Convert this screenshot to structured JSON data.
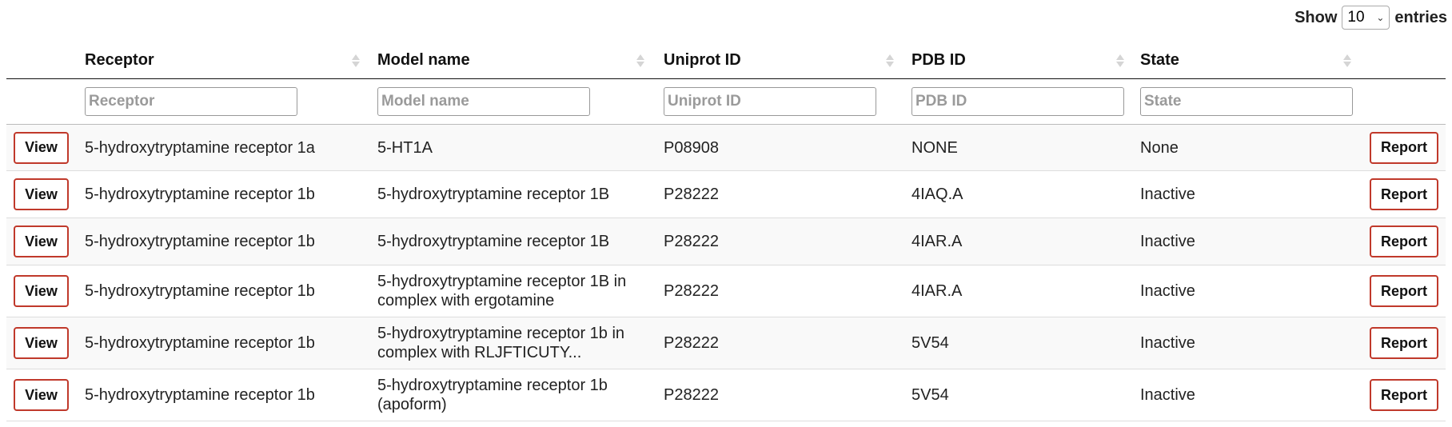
{
  "length_control": {
    "prefix": "Show",
    "selected": "10",
    "suffix": "entries"
  },
  "columns": [
    {
      "key": "receptor",
      "label": "Receptor",
      "placeholder": "Receptor"
    },
    {
      "key": "model_name",
      "label": "Model name",
      "placeholder": "Model name"
    },
    {
      "key": "uniprot_id",
      "label": "Uniprot ID",
      "placeholder": "Uniprot ID"
    },
    {
      "key": "pdb_id",
      "label": "PDB ID",
      "placeholder": "PDB ID"
    },
    {
      "key": "state",
      "label": "State",
      "placeholder": "State"
    }
  ],
  "buttons": {
    "view": "View",
    "report": "Report"
  },
  "rows": [
    {
      "receptor": "5-hydroxytryptamine receptor 1a",
      "model_name": "5-HT1A",
      "uniprot_id": "P08908",
      "pdb_id": "NONE",
      "state": "None"
    },
    {
      "receptor": "5-hydroxytryptamine receptor 1b",
      "model_name": "5-hydroxytryptamine receptor 1B",
      "uniprot_id": "P28222",
      "pdb_id": "4IAQ.A",
      "state": "Inactive"
    },
    {
      "receptor": "5-hydroxytryptamine receptor 1b",
      "model_name": "5-hydroxytryptamine receptor 1B",
      "uniprot_id": "P28222",
      "pdb_id": "4IAR.A",
      "state": "Inactive"
    },
    {
      "receptor": "5-hydroxytryptamine receptor 1b",
      "model_name": "5-hydroxytryptamine receptor 1B in complex with ergotamine",
      "uniprot_id": "P28222",
      "pdb_id": "4IAR.A",
      "state": "Inactive"
    },
    {
      "receptor": "5-hydroxytryptamine receptor 1b",
      "model_name": "5-hydroxytryptamine receptor 1b in complex with RLJFTICUTY...",
      "uniprot_id": "P28222",
      "pdb_id": "5V54",
      "state": "Inactive"
    },
    {
      "receptor": "5-hydroxytryptamine receptor 1b",
      "model_name": "5-hydroxytryptamine receptor 1b (apoform)",
      "uniprot_id": "P28222",
      "pdb_id": "5V54",
      "state": "Inactive"
    }
  ]
}
